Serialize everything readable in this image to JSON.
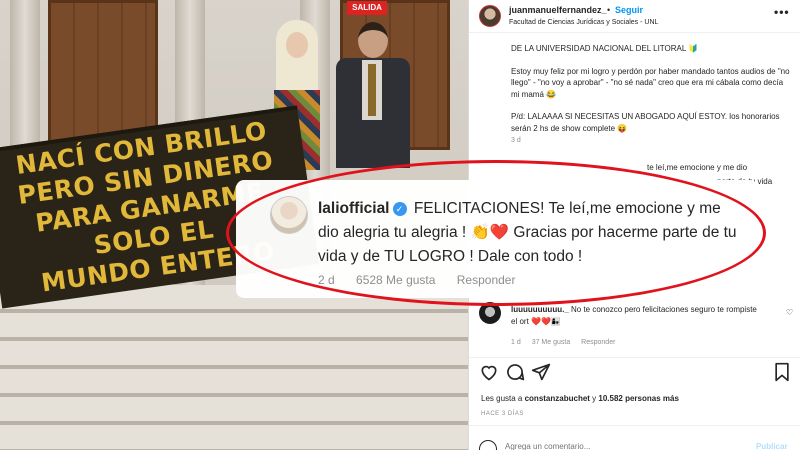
{
  "photo": {
    "exit_sign": "SALIDA",
    "banner_lines": [
      "NACÍ CON BRILLO",
      "PERO SIN DINERO",
      "PARA GANARME",
      "SOLO EL",
      "MUNDO ENTERO"
    ]
  },
  "post_header": {
    "username": "juanmanuelfernandez_",
    "separator": "•",
    "follow_label": "Seguir",
    "location": "Facultad de Ciencias Jurídicas y Sociales - UNL",
    "more_icon": "more-icon"
  },
  "caption": {
    "paragraphs": [
      "DE LA UNIVERSIDAD NACIONAL DEL LITORAL 🔰",
      "Estoy muy feliz por mi logro y perdón por haber mandado tantos audios de \"no llego\" - \"no voy a aprobar\" - \"no sé nada\" creo que era mi cábala como decía mi mamá 😂",
      "P/d: LALAAAA SI NECESITAS UN ABOGADO AQUÍ ESTOY. los honorarios serán 2 hs de show complete 😝"
    ],
    "time": "3 d"
  },
  "partial_comment": {
    "line1": "te leí,me emocione y me dio",
    "line2": "parte de tu vida"
  },
  "zoomed_comment": {
    "username": "laliofficial",
    "verified_mark": "✓",
    "text": "FELICITACIONES! Te leí,me emocione y me dio alegria tu alegria ! 👏❤️ Gracias por hacerme parte de tu vida y de TU LOGRO ! Dale con todo !",
    "time": "2 d",
    "likes": "6528 Me gusta",
    "reply_label": "Responder"
  },
  "comment2": {
    "username": "luuuuuuuuuu._",
    "text": "No te conozco pero felicitaciones seguro te rompiste el ort ❤️❤️👩‍👧",
    "time": "1 d",
    "likes": "37 Me gusta",
    "reply_label": "Responder"
  },
  "likes_line": {
    "prefix": "Les gusta a ",
    "user": "constanzabuchet",
    "middle": " y ",
    "count": "10.582 personas más"
  },
  "time_ago": "HACE 3 DÍAS",
  "add_comment": {
    "placeholder": "Agrega un comentario...",
    "post_label": "Publicar"
  },
  "colors": {
    "accent": "#0095f6",
    "ring": "#e0131d",
    "banner_text": "#e2b83a"
  }
}
